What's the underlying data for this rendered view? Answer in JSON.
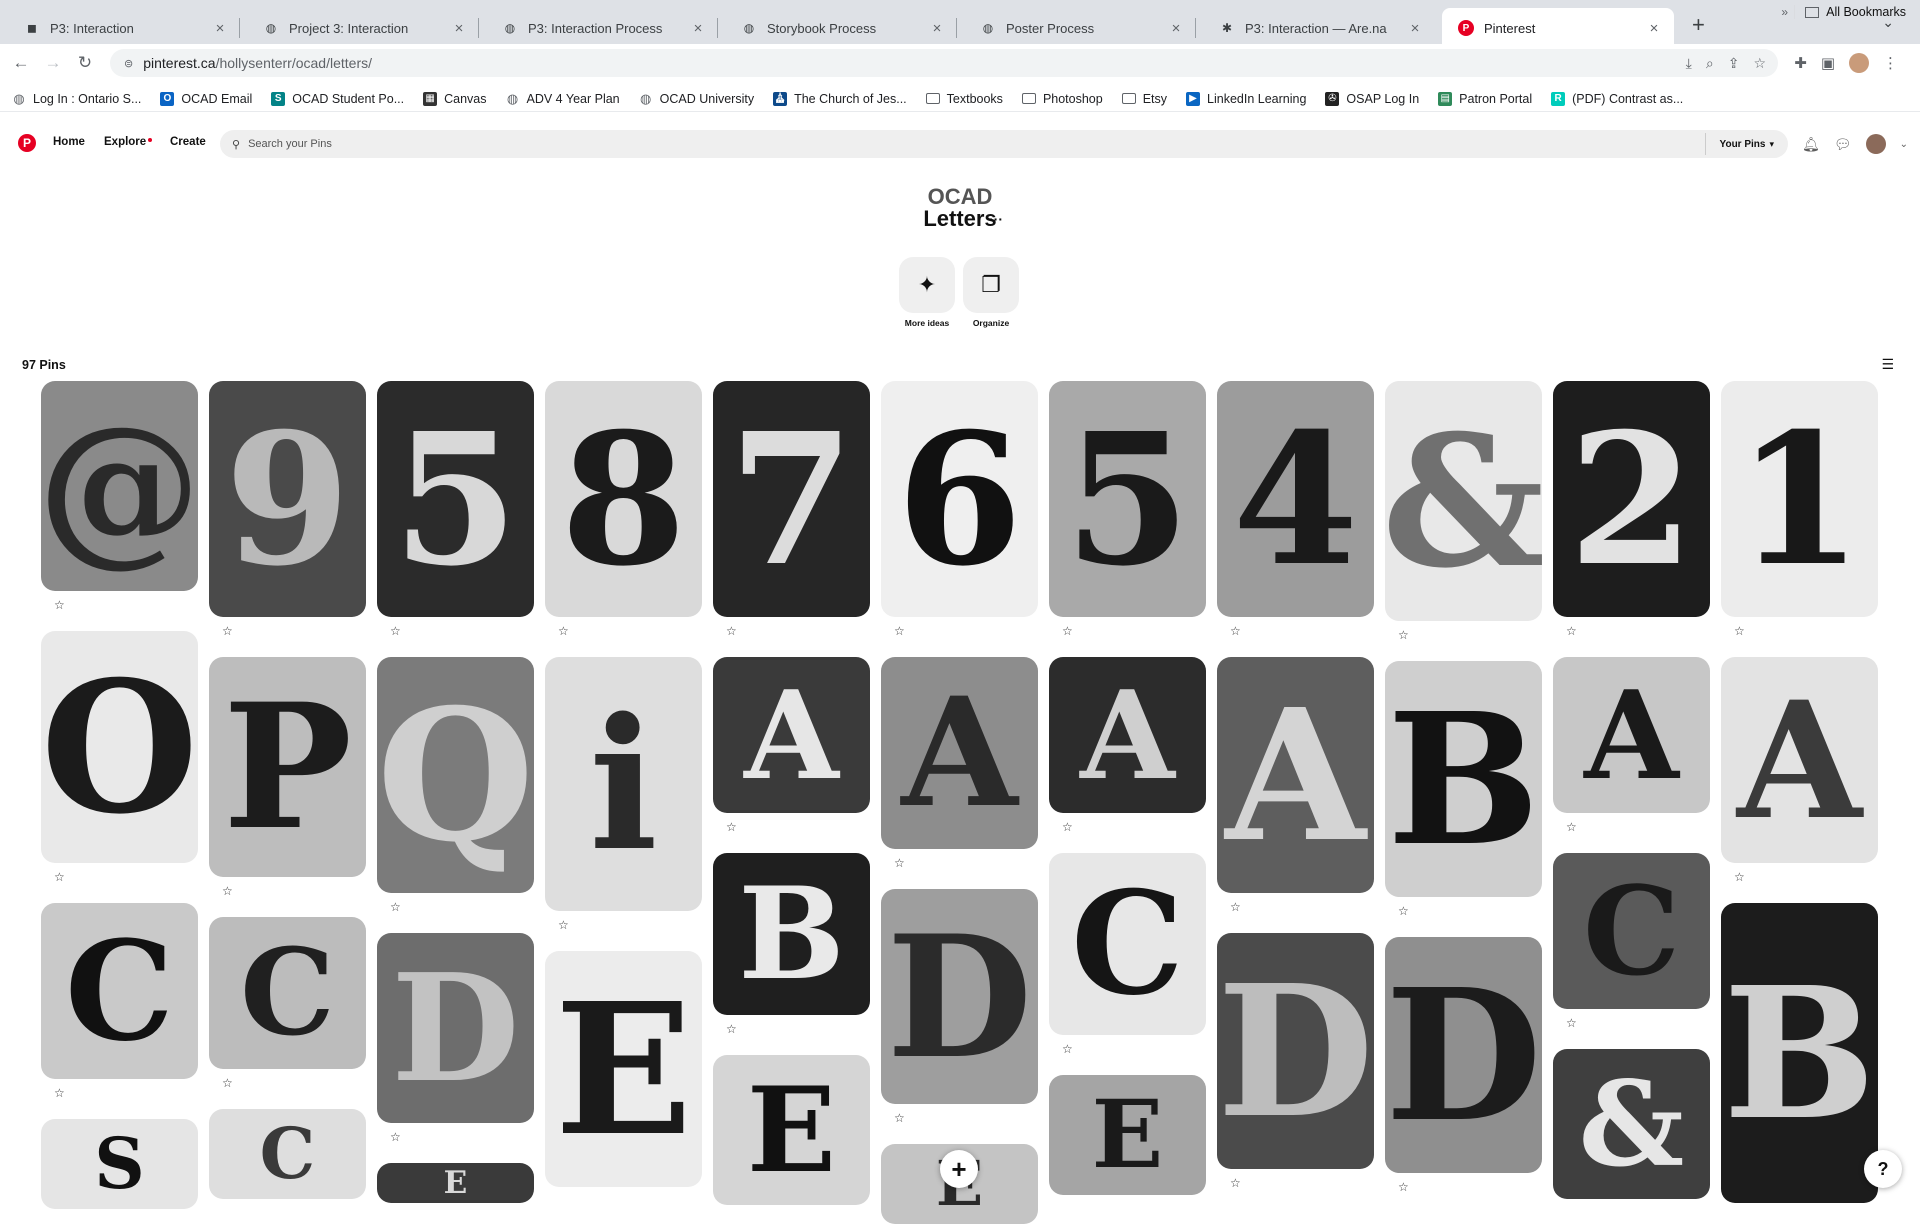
{
  "tabs": [
    {
      "title": "P3: Interaction",
      "favicon": "notion-icon",
      "active": false
    },
    {
      "title": "Project 3: Interaction",
      "favicon": "globe-icon",
      "active": false
    },
    {
      "title": "P3: Interaction Process",
      "favicon": "globe-icon",
      "active": false
    },
    {
      "title": "Storybook Process",
      "favicon": "globe-icon",
      "active": false
    },
    {
      "title": "Poster Process",
      "favicon": "globe-icon",
      "active": false
    },
    {
      "title": "P3: Interaction — Are.na",
      "favicon": "arena-icon",
      "active": false
    },
    {
      "title": "Pinterest",
      "favicon": "pinterest-icon",
      "active": true
    }
  ],
  "address": {
    "host": "pinterest.ca",
    "path": "/hollysenterr/ocad/letters/"
  },
  "bookmarks": [
    {
      "label": "Log In : Ontario S...",
      "icon": "globe-icon",
      "color": "#5f6368"
    },
    {
      "label": "OCAD Email",
      "icon": "outlook-icon",
      "color": "#0a64c4"
    },
    {
      "label": "OCAD Student Po...",
      "icon": "sharepoint-icon",
      "color": "#038387"
    },
    {
      "label": "Canvas",
      "icon": "canvas-icon",
      "color": "#333333"
    },
    {
      "label": "ADV 4 Year Plan",
      "icon": "globe-icon",
      "color": "#5f6368"
    },
    {
      "label": "OCAD University",
      "icon": "globe-icon",
      "color": "#5f6368"
    },
    {
      "label": "The Church of Jes...",
      "icon": "church-icon",
      "color": "#0d4a8a"
    },
    {
      "label": "Textbooks",
      "icon": "folder-icon",
      "color": "#5f6368"
    },
    {
      "label": "Photoshop",
      "icon": "folder-icon",
      "color": "#5f6368"
    },
    {
      "label": "Etsy",
      "icon": "folder-icon",
      "color": "#5f6368"
    },
    {
      "label": "LinkedIn Learning",
      "icon": "linkedin-icon",
      "color": "#0a66c2"
    },
    {
      "label": "OSAP Log In",
      "icon": "osap-icon",
      "color": "#222222"
    },
    {
      "label": "Patron Portal",
      "icon": "book-icon",
      "color": "#2f8a5a"
    },
    {
      "label": "(PDF) Contrast as...",
      "icon": "researchgate-icon",
      "color": "#00ccbb"
    }
  ],
  "all_bookmarks": "All Bookmarks",
  "pinterest": {
    "nav": {
      "home": "Home",
      "explore": "Explore",
      "create": "Create"
    },
    "search_placeholder": "Search your Pins",
    "your_pins": "Your Pins"
  },
  "board": {
    "parent": "OCAD",
    "title": "Letters",
    "more_ideas": "More ideas",
    "organize": "Organize",
    "pin_count": "97 Pins"
  },
  "pins": [
    {
      "glyph": "@",
      "bg": "#8a8a8a",
      "fg": "#2a2a2a"
    },
    {
      "glyph": "9",
      "bg": "#4a4a4a",
      "fg": "#b9b9b9"
    },
    {
      "glyph": "5",
      "bg": "#2b2b2b",
      "fg": "#d8d8d8"
    },
    {
      "glyph": "8",
      "bg": "#d9d9d9",
      "fg": "#1b1b1b"
    },
    {
      "glyph": "7",
      "bg": "#262626",
      "fg": "#dcdcdc"
    },
    {
      "glyph": "6",
      "bg": "#efefef",
      "fg": "#111111"
    },
    {
      "glyph": "5",
      "bg": "#a9a9a9",
      "fg": "#1a1a1a"
    },
    {
      "glyph": "4",
      "bg": "#9c9c9c",
      "fg": "#1a1a1a"
    },
    {
      "glyph": "&",
      "bg": "#e8e8e8",
      "fg": "#707070"
    },
    {
      "glyph": "2",
      "bg": "#1d1d1d",
      "fg": "#e2e2e2"
    },
    {
      "glyph": "1",
      "bg": "#ececec",
      "fg": "#181818"
    },
    {
      "glyph": "O",
      "bg": "#e9e9e9",
      "fg": "#1b1b1b"
    },
    {
      "glyph": "P",
      "bg": "#bdbdbd",
      "fg": "#1c1c1c"
    },
    {
      "glyph": "Q",
      "bg": "#7b7b7b",
      "fg": "#cfcfcf"
    },
    {
      "glyph": "i",
      "bg": "#dedede",
      "fg": "#2a2a2a"
    },
    {
      "glyph": "A",
      "bg": "#3a3a3a",
      "fg": "#e6e6e6"
    },
    {
      "glyph": "A",
      "bg": "#8d8d8d",
      "fg": "#2a2a2a"
    },
    {
      "glyph": "A",
      "bg": "#2c2c2c",
      "fg": "#cfcfcf"
    },
    {
      "glyph": "A",
      "bg": "#5e5e5e",
      "fg": "#d4d4d4"
    },
    {
      "glyph": "B",
      "bg": "#cfcfcf",
      "fg": "#121212"
    },
    {
      "glyph": "A",
      "bg": "#c7c7c7",
      "fg": "#1a1a1a"
    },
    {
      "glyph": "A",
      "bg": "#e3e3e3",
      "fg": "#3b3b3b"
    },
    {
      "glyph": "C",
      "bg": "#c9c9c9",
      "fg": "#111111"
    },
    {
      "glyph": "C",
      "bg": "#bcbcbc",
      "fg": "#202020"
    },
    {
      "glyph": "D",
      "bg": "#6d6d6d",
      "fg": "#c2c2c2"
    },
    {
      "glyph": "E",
      "bg": "#ececec",
      "fg": "#1a1a1a"
    },
    {
      "glyph": "B",
      "bg": "#1f1f1f",
      "fg": "#e9e9e9"
    },
    {
      "glyph": "D",
      "bg": "#9e9e9e",
      "fg": "#2b2b2b"
    },
    {
      "glyph": "C",
      "bg": "#e7e7e7",
      "fg": "#151515"
    },
    {
      "glyph": "D",
      "bg": "#4b4b4b",
      "fg": "#bdbdbd"
    },
    {
      "glyph": "D",
      "bg": "#8f8f8f",
      "fg": "#1c1c1c"
    },
    {
      "glyph": "C",
      "bg": "#5a5a5a",
      "fg": "#1a1a1a"
    },
    {
      "glyph": "B",
      "bg": "#1c1c1c",
      "fg": "#cfcfcf"
    },
    {
      "glyph": "S",
      "bg": "#e5e5e5",
      "fg": "#111111"
    },
    {
      "glyph": "C",
      "bg": "#dedede",
      "fg": "#3a3a3a"
    },
    {
      "glyph": "E",
      "bg": "#3a3a3a",
      "fg": "#d9d9d9"
    },
    {
      "glyph": "E",
      "bg": "#d5d5d5",
      "fg": "#111111"
    },
    {
      "glyph": "E",
      "bg": "#c4c4c4",
      "fg": "#2a2a2a"
    },
    {
      "glyph": "E",
      "bg": "#a5a5a5",
      "fg": "#1a1a1a"
    },
    {
      "glyph": "&",
      "bg": "#3f3f3f",
      "fg": "#e6e6e6"
    }
  ]
}
